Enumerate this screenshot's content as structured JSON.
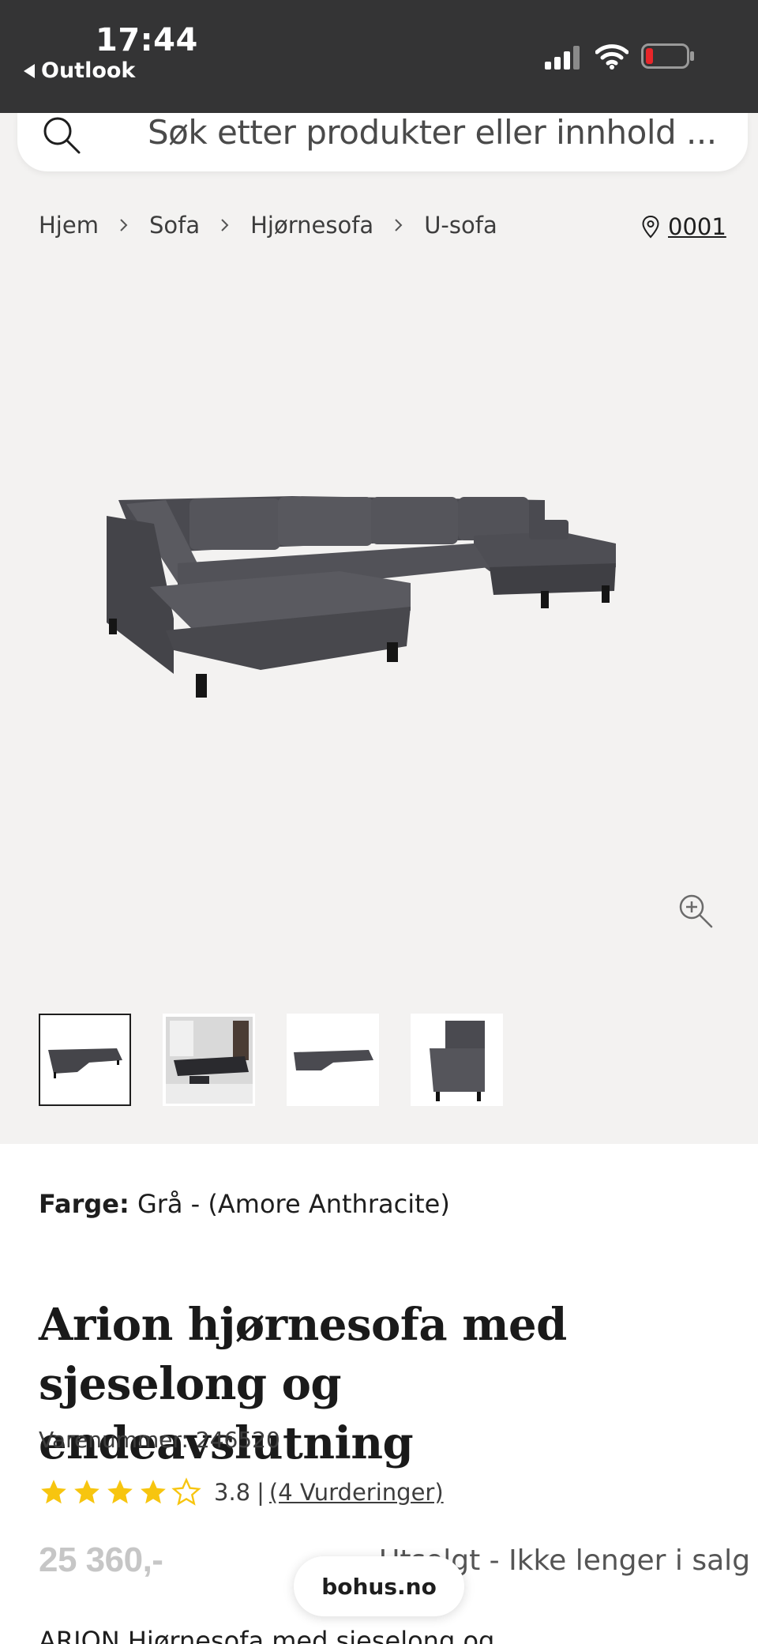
{
  "status_bar": {
    "time": "17:44",
    "back_app": "Outlook"
  },
  "search": {
    "placeholder": "Søk etter produkter eller innhold ..."
  },
  "breadcrumb": {
    "items": [
      "Hjem",
      "Sofa",
      "Hjørnesofa",
      "U-sofa"
    ]
  },
  "store": {
    "code": "0001"
  },
  "product": {
    "color_label": "Farge:",
    "color_value": "Grå - (Amore Anthracite)",
    "title": "Arion hjørnesofa med sjeselong og endeavslutning",
    "sku_label": "Varenummer:",
    "sku_value": "246520",
    "rating_value": "3.8",
    "rating_fraction": 0.76,
    "rating_separator": "|",
    "rating_count": "(4 Vurderinger)",
    "price": "25 360,-",
    "status": "Utsolgt - Ikke lenger i salg",
    "description_start": "ARION Hjørnesofa med sjeselong og"
  },
  "domain_pill": "bohus.no",
  "colors": {
    "status_bar_bg": "#343435",
    "gallery_bg": "#f3f2f1",
    "star": "#f7c50f",
    "price_muted": "#c6c6c6"
  },
  "icons": [
    "search-icon",
    "chevron-right-icon",
    "location-pin-icon",
    "zoom-in-icon",
    "star-icon",
    "signal-icon",
    "wifi-icon",
    "battery-icon"
  ]
}
